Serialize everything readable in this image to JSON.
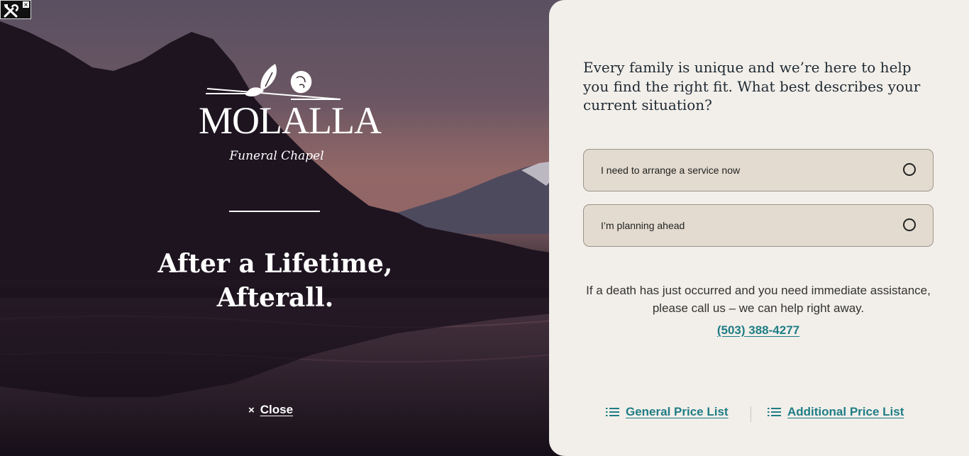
{
  "hero": {
    "logo_word": "MOLALLA",
    "logo_script": "Funeral Chapel",
    "tagline_line1": "After a Lifetime,",
    "tagline_line2": "Afterall.",
    "close_label": "Close",
    "close_icon": "×"
  },
  "panel": {
    "question": "Every family is unique and we’re here to help you find the right fit. What best describes your current situation?",
    "options": [
      {
        "label": "I need to arrange a service now"
      },
      {
        "label": "I’m planning ahead"
      }
    ],
    "notice": "If a death has just occurred and you need immediate assistance, please call us – we can help right away.",
    "phone": "(503) 388-4277",
    "links": {
      "general": "General Price List",
      "additional": "Additional Price List"
    }
  },
  "colors": {
    "panel_bg": "#f2efea",
    "option_bg": "#e3dbcf",
    "accent": "#1f7d85",
    "heading": "#1f2a33"
  }
}
